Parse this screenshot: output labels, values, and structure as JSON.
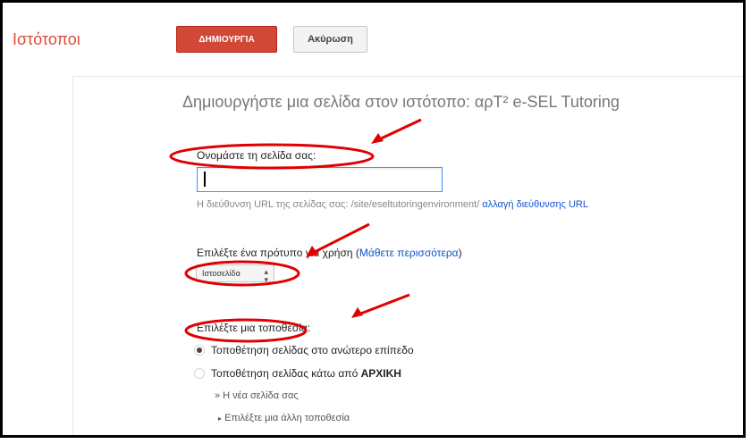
{
  "header": {
    "app_title": "Ιστότοποι",
    "create_label": "ΔΗΜΙΟΥΡΓΙΑ",
    "cancel_label": "Ακύρωση"
  },
  "form": {
    "heading": "Δημιουργήστε μια σελίδα στον ιστότοπο: αρΤ² e-SEL Tutoring",
    "name_label": "Ονομάστε τη σελίδα σας:",
    "name_value": "",
    "url_prefix": "Η διεύθυνση URL της σελίδας σας: /site/eseltutoringenvironment/",
    "url_change_link": "αλλαγή διεύθυνσης URL",
    "template_label": "Επιλέξτε ένα πρότυπο για χρήση (",
    "template_link": "Μάθετε περισσότερα",
    "template_label_end": ")",
    "template_selected": "Ιστοσελίδα",
    "location_label": "Επιλέξτε μια τοποθεσία:",
    "location_options": [
      {
        "label": "Τοποθέτηση σελίδας στο ανώτερο επίπεδο",
        "checked": true
      },
      {
        "label_prefix": "Τοποθέτηση σελίδας κάτω από ",
        "label_bold": "ΑΡΧΙΚΗ",
        "checked": false
      }
    ],
    "new_page_path": "» Η νέα σελίδα σας",
    "other_location": "Επιλέξτε μια άλλη τοποθεσία"
  },
  "annotation_color": "#e00000"
}
